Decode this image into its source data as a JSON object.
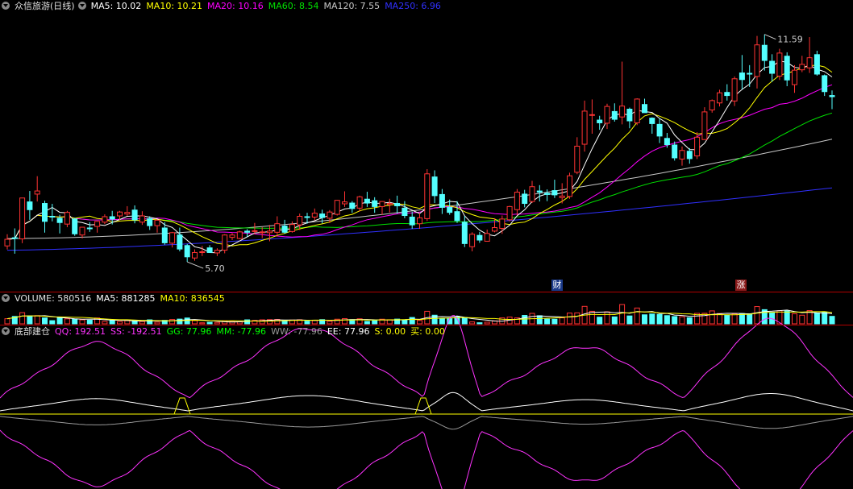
{
  "price_header": {
    "stock": "众信旅游(日线)",
    "ma5": "MA5: 10.02",
    "ma10": "MA10: 10.21",
    "ma20": "MA20: 10.16",
    "ma60": "MA60: 8.54",
    "ma120": "MA120: 7.55",
    "ma250": "MA250: 6.96"
  },
  "volume_header": {
    "volume": "VOLUME: 580516",
    "ma5": "MA5: 881285",
    "ma10": "MA10: 836545"
  },
  "indicator_header": {
    "name": "底部建仓",
    "qq": "QQ: 192.51",
    "ss": "SS: -192.51",
    "gg": "GG: 77.96",
    "mm": "MM: -77.96",
    "ww": "WW: -77.96",
    "ee": "EE: 77.96",
    "s": "S: 0.00",
    "buy": "买: 0.00"
  },
  "markers": {
    "caibao": "财",
    "zhangting": "涨"
  },
  "colors": {
    "up": "#ff3333",
    "down": "#54ffff",
    "ma5": "#ffffff",
    "ma10": "#ffff00",
    "ma20": "#ff00ff",
    "ma60": "#00e000",
    "ma120": "#c8c8c8",
    "ma250": "#3030ff",
    "divider": "#b00000"
  },
  "chart_data": {
    "type": "candlestick",
    "high_label": "11.59",
    "low_label": "5.70",
    "price_range": [
      5.4,
      12.1
    ],
    "ohlc": [
      [
        6.16,
        6.46,
        6.07,
        6.33
      ],
      [
        6.37,
        6.61,
        5.96,
        6.36
      ],
      [
        6.34,
        7.39,
        6.23,
        7.39
      ],
      [
        7.29,
        7.57,
        6.83,
        7.09
      ],
      [
        7.49,
        7.95,
        7.3,
        7.57
      ],
      [
        7.25,
        7.32,
        6.5,
        6.79
      ],
      [
        6.92,
        7.24,
        6.79,
        6.9
      ],
      [
        6.87,
        6.96,
        6.48,
        6.76
      ],
      [
        6.72,
        7.06,
        6.64,
        7.02
      ],
      [
        6.85,
        6.88,
        6.42,
        6.47
      ],
      [
        6.44,
        6.65,
        6.35,
        6.64
      ],
      [
        6.62,
        6.77,
        6.52,
        6.61
      ],
      [
        6.66,
        6.8,
        6.5,
        6.79
      ],
      [
        6.77,
        6.97,
        6.72,
        6.91
      ],
      [
        6.91,
        7.06,
        6.71,
        6.85
      ],
      [
        6.93,
        7.06,
        6.82,
        7.03
      ],
      [
        6.98,
        7.18,
        6.93,
        7.02
      ],
      [
        7.08,
        7.2,
        6.74,
        6.83
      ],
      [
        6.77,
        7.05,
        6.7,
        6.93
      ],
      [
        6.86,
        6.92,
        6.57,
        6.68
      ],
      [
        6.68,
        6.84,
        6.5,
        6.82
      ],
      [
        6.62,
        6.77,
        6.19,
        6.24
      ],
      [
        6.23,
        6.52,
        6.12,
        6.5
      ],
      [
        6.44,
        6.63,
        6.02,
        6.08
      ],
      [
        6.17,
        6.21,
        5.75,
        5.88
      ],
      [
        5.85,
        6.07,
        5.78,
        5.99
      ],
      [
        6.0,
        6.16,
        5.9,
        6.01
      ],
      [
        6.11,
        6.18,
        5.98,
        5.99
      ],
      [
        5.98,
        6.1,
        5.9,
        6.05
      ],
      [
        6.05,
        6.46,
        5.97,
        6.44
      ],
      [
        6.38,
        6.49,
        6.31,
        6.44
      ],
      [
        6.35,
        6.55,
        6.33,
        6.52
      ],
      [
        6.54,
        6.59,
        6.39,
        6.51
      ],
      [
        6.53,
        6.75,
        6.46,
        6.55
      ],
      [
        6.52,
        6.64,
        6.36,
        6.52
      ],
      [
        6.5,
        6.7,
        6.28,
        6.54
      ],
      [
        6.51,
        6.92,
        6.4,
        6.73
      ],
      [
        6.67,
        6.83,
        6.47,
        6.51
      ],
      [
        6.53,
        6.79,
        6.5,
        6.71
      ],
      [
        6.7,
        6.99,
        6.57,
        6.92
      ],
      [
        6.91,
        7.01,
        6.73,
        6.89
      ],
      [
        6.9,
        7.12,
        6.82,
        7.0
      ],
      [
        6.98,
        7.09,
        6.74,
        6.89
      ],
      [
        6.87,
        7.08,
        6.75,
        7.03
      ],
      [
        6.97,
        7.34,
        6.94,
        7.33
      ],
      [
        7.24,
        7.56,
        7.16,
        7.29
      ],
      [
        7.26,
        7.31,
        7.01,
        7.12
      ],
      [
        7.13,
        7.45,
        7.04,
        7.42
      ],
      [
        7.36,
        7.55,
        7.16,
        7.26
      ],
      [
        7.32,
        7.41,
        7.01,
        7.17
      ],
      [
        7.17,
        7.31,
        6.96,
        7.3
      ],
      [
        7.22,
        7.37,
        7.02,
        7.25
      ],
      [
        7.25,
        7.45,
        6.99,
        7.19
      ],
      [
        7.13,
        7.31,
        6.87,
        6.94
      ],
      [
        6.9,
        7.04,
        6.6,
        6.7
      ],
      [
        6.73,
        7.0,
        6.6,
        6.88
      ],
      [
        6.86,
        8.13,
        6.8,
        8.01
      ],
      [
        7.93,
        8.1,
        7.26,
        7.45
      ],
      [
        7.48,
        7.62,
        6.98,
        7.15
      ],
      [
        7.15,
        7.35,
        6.96,
        7.02
      ],
      [
        7.04,
        7.31,
        6.75,
        6.81
      ],
      [
        6.77,
        6.93,
        6.13,
        6.22
      ],
      [
        6.14,
        6.51,
        6.02,
        6.46
      ],
      [
        6.43,
        6.52,
        6.24,
        6.31
      ],
      [
        6.28,
        6.58,
        6.27,
        6.48
      ],
      [
        6.54,
        6.87,
        6.51,
        6.63
      ],
      [
        6.61,
        6.94,
        6.47,
        6.85
      ],
      [
        6.83,
        7.19,
        6.79,
        7.17
      ],
      [
        7.09,
        7.62,
        6.95,
        7.54
      ],
      [
        7.49,
        7.6,
        7.15,
        7.25
      ],
      [
        7.3,
        7.83,
        7.26,
        7.68
      ],
      [
        7.57,
        7.72,
        7.3,
        7.54
      ],
      [
        7.51,
        7.61,
        7.31,
        7.48
      ],
      [
        7.58,
        7.86,
        7.39,
        7.47
      ],
      [
        7.4,
        7.77,
        7.25,
        7.44
      ],
      [
        7.43,
        8.04,
        7.37,
        7.96
      ],
      [
        8.05,
        8.95,
        8.0,
        8.72
      ],
      [
        8.77,
        9.89,
        8.58,
        9.62
      ],
      [
        9.51,
        9.92,
        9.04,
        9.53
      ],
      [
        9.39,
        9.5,
        9.14,
        9.32
      ],
      [
        9.31,
        9.81,
        9.16,
        9.74
      ],
      [
        9.61,
        9.82,
        9.35,
        9.41
      ],
      [
        9.47,
        10.89,
        9.28,
        9.75
      ],
      [
        9.67,
        9.71,
        9.18,
        9.37
      ],
      [
        9.32,
        9.95,
        9.26,
        9.93
      ],
      [
        9.79,
        9.94,
        9.58,
        9.58
      ],
      [
        9.44,
        9.46,
        9.04,
        9.3
      ],
      [
        9.28,
        9.43,
        8.8,
        8.98
      ],
      [
        8.92,
        9.06,
        8.68,
        8.76
      ],
      [
        8.75,
        8.84,
        8.35,
        8.42
      ],
      [
        8.39,
        8.71,
        8.22,
        8.61
      ],
      [
        8.59,
        8.67,
        8.27,
        8.4
      ],
      [
        8.47,
        9.08,
        8.39,
        8.95
      ],
      [
        8.89,
        9.72,
        8.89,
        9.6
      ],
      [
        9.65,
        9.92,
        9.58,
        9.89
      ],
      [
        9.83,
        10.17,
        9.74,
        10.09
      ],
      [
        10.1,
        10.31,
        9.89,
        10.02
      ],
      [
        9.88,
        10.51,
        9.75,
        10.45
      ],
      [
        10.6,
        11.06,
        10.18,
        10.43
      ],
      [
        10.59,
        10.8,
        10.24,
        10.58
      ],
      [
        10.51,
        11.55,
        10.2,
        11.32
      ],
      [
        11.31,
        11.59,
        10.66,
        10.92
      ],
      [
        10.9,
        11.08,
        10.37,
        10.59
      ],
      [
        10.52,
        11.22,
        10.42,
        11.11
      ],
      [
        11.03,
        11.13,
        10.26,
        10.42
      ],
      [
        10.3,
        10.8,
        10.09,
        10.67
      ],
      [
        10.68,
        11.04,
        10.62,
        10.82
      ],
      [
        10.73,
        11.52,
        10.6,
        10.99
      ],
      [
        11.07,
        11.17,
        10.53,
        10.57
      ],
      [
        10.53,
        10.56,
        10.01,
        10.12
      ],
      [
        10.02,
        10.15,
        9.67,
        9.99
      ]
    ],
    "volume": [
      0.5,
      0.72,
      1.09,
      0.78,
      0.8,
      0.58,
      0.31,
      0.63,
      0.49,
      0.45,
      0.39,
      0.35,
      0.57,
      0.23,
      0.34,
      0.22,
      0.31,
      0.3,
      0.23,
      0.39,
      0.16,
      0.34,
      0.42,
      0.46,
      0.57,
      0.32,
      0.1,
      0.16,
      0.14,
      0.29,
      0.22,
      0.19,
      0.39,
      0.34,
      0.39,
      0.41,
      0.43,
      0.29,
      0.37,
      0.4,
      0.26,
      0.33,
      0.41,
      0.25,
      0.45,
      0.51,
      0.41,
      0.49,
      0.24,
      0.31,
      0.45,
      0.4,
      0.46,
      0.38,
      0.62,
      0.33,
      1.22,
      0.84,
      0.51,
      0.5,
      0.72,
      0.62,
      0.19,
      0.11,
      0.16,
      0.29,
      0.58,
      0.66,
      0.58,
      0.82,
      1.02,
      0.79,
      0.46,
      0.45,
      0.59,
      1.05,
      1.07,
      1.7,
      1.22,
      0.65,
      1.17,
      0.68,
      1.88,
      0.77,
      1.54,
      0.88,
      0.96,
      0.91,
      0.8,
      0.71,
      0.69,
      0.59,
      1.02,
      1.03,
      1.26,
      1.0,
      0.82,
      0.97,
      1.0,
      0.98,
      1.68,
      1.38,
      1.1,
      1.28,
      1.25,
      0.98,
      0.84,
      1.29,
      1.02,
      1.13,
      0.73
    ]
  }
}
